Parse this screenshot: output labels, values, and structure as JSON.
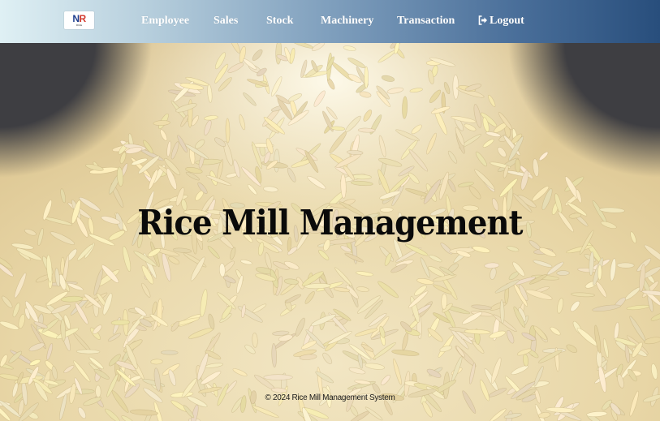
{
  "logo": {
    "mark_left": "N",
    "mark_right": "R",
    "subtext": "RICE"
  },
  "nav": {
    "employee": "Employee",
    "sales": "Sales",
    "stock": "Stock",
    "machinery": "Machinery",
    "transaction": "Transaction",
    "logout": "Logout"
  },
  "hero": {
    "title": "Rice Mill Management"
  },
  "footer": {
    "copyright": "© 2024 Rice Mill Management System"
  },
  "colors": {
    "navbar_start": "#dff0f4",
    "navbar_end": "#284e7c",
    "nav_text": "#ffffff",
    "title_text": "#0a0a0a"
  },
  "icons": {
    "logout": "sign-out-icon"
  }
}
